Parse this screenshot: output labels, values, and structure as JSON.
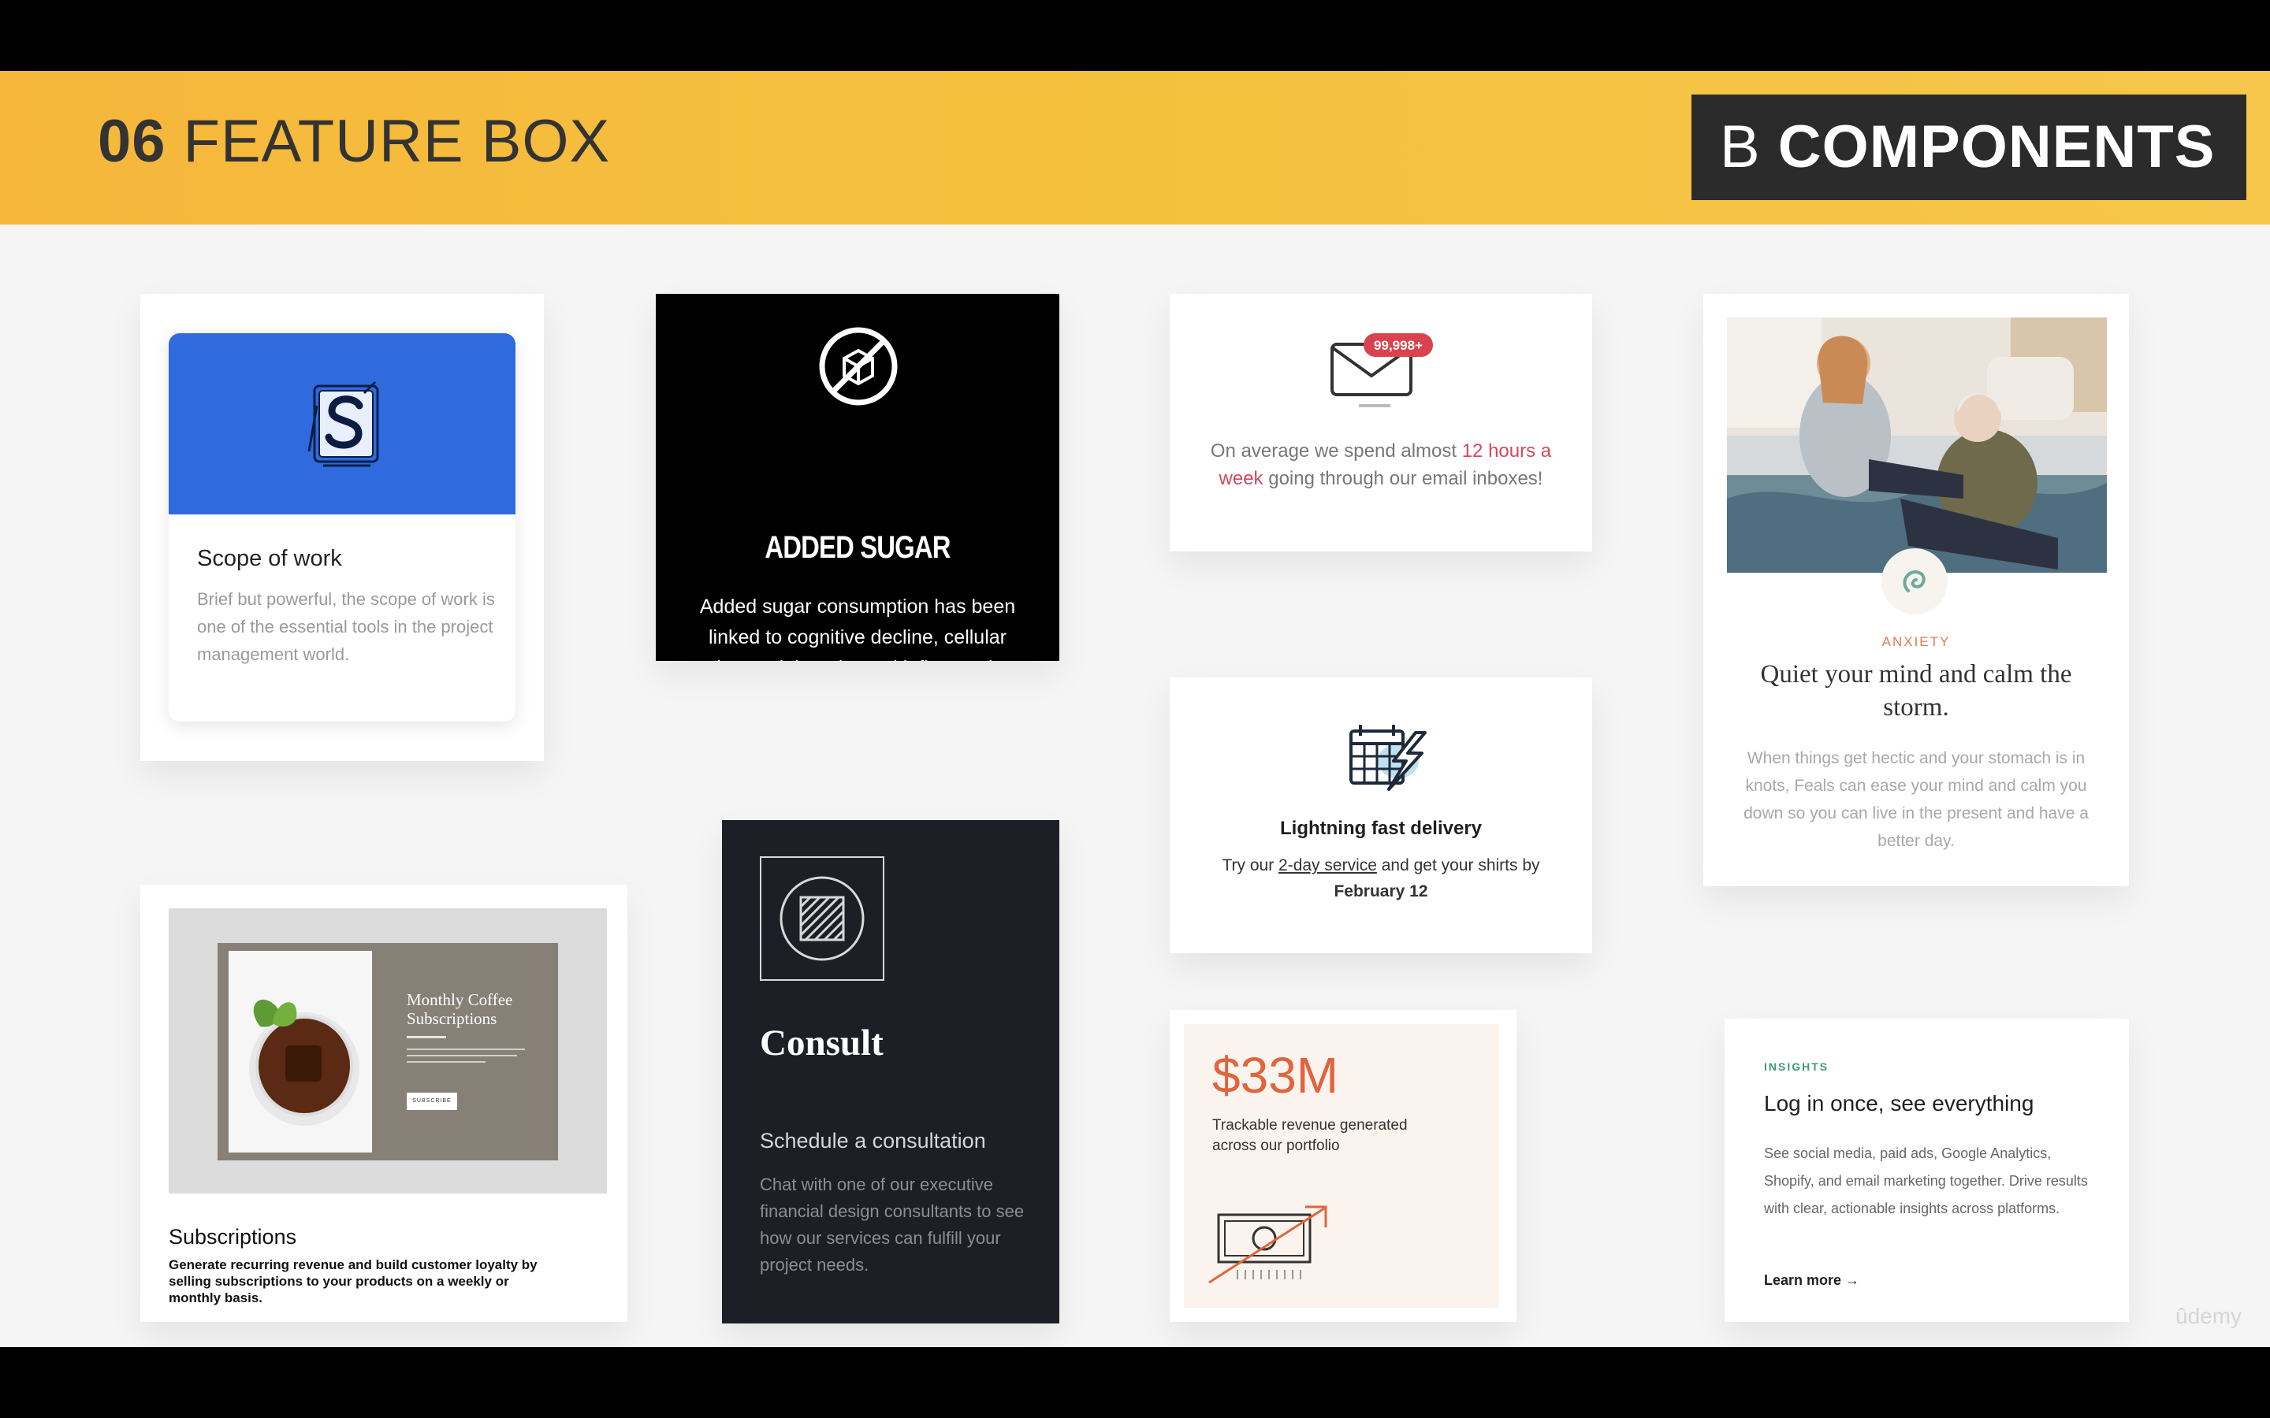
{
  "banner": {
    "number": "06",
    "title": "FEATURE BOX",
    "badge_letter": "B",
    "badge_text": "COMPONENTS"
  },
  "scope": {
    "title": "Scope of work",
    "text": "Brief but powerful, the scope of work is one of the essential tools in the project management world."
  },
  "sugar": {
    "title": "ADDED SUGAR",
    "text": "Added sugar consumption has been linked to cognitive decline, cellular aging, weight gain, and inflammation."
  },
  "email": {
    "badge": "99,998+",
    "text_before": "On average we spend almost ",
    "highlight": "12 hours a week",
    "text_after": " going through our email inboxes!"
  },
  "anxiety": {
    "tag": "ANXIETY",
    "title": "Quiet your mind and calm the storm.",
    "text": "When things get hectic and your stomach is in knots, Feals can ease your mind and calm you down so you can live in the present and have a better day."
  },
  "subscriptions": {
    "shot_title": "Monthly Coffee Subscriptions",
    "shot_button": "SUBSCRIBE",
    "title": "Subscriptions",
    "text": "Generate recurring revenue and build customer loyalty by selling subscriptions to your products on a weekly or monthly basis."
  },
  "consult": {
    "title": "Consult",
    "subtitle": "Schedule a consultation",
    "text": "Chat with one of our executive financial design consultants to see how our services can fulfill your project needs."
  },
  "delivery": {
    "title": "Lightning fast delivery",
    "text_before": "Try our ",
    "link": "2-day service",
    "text_middle": " and get your shirts by ",
    "date": "February 12"
  },
  "revenue": {
    "value": "$33M",
    "text": "Trackable revenue generated across our portfolio"
  },
  "insights": {
    "tag": "INSIGHTS",
    "title": "Log in once, see everything",
    "text": "See social media, paid ads, Google Analytics, Shopify, and email marketing together. Drive results with clear, actionable insights across platforms.",
    "link": "Learn more →"
  },
  "watermark": "ûdemy"
}
